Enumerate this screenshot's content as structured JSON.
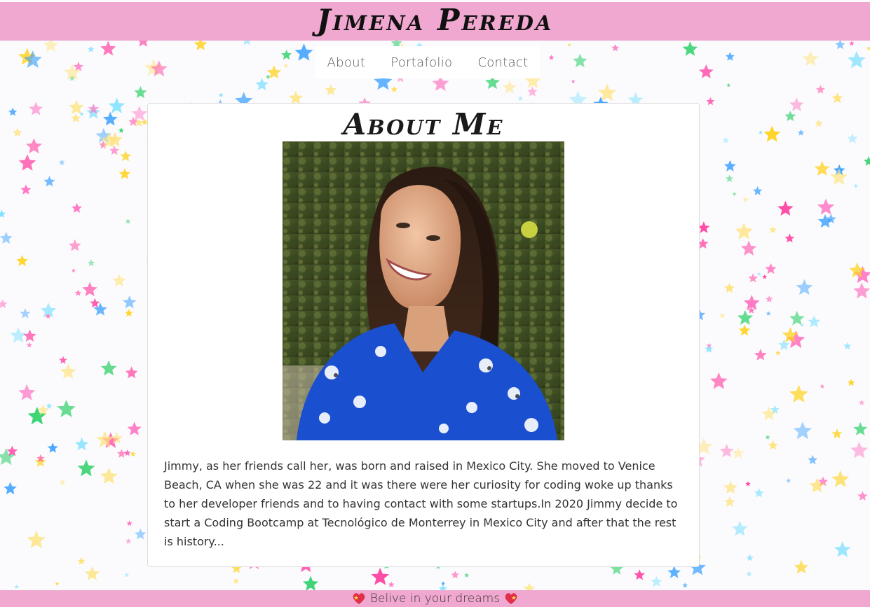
{
  "header": {
    "brand": "Jimena Pereda"
  },
  "nav": {
    "items": [
      {
        "label": "About"
      },
      {
        "label": "Portafolio"
      },
      {
        "label": "Contact"
      }
    ]
  },
  "about": {
    "title": "About Me",
    "photo_icon": "portrait-photo",
    "bio": "Jimmy, as her friends call her, was born and raised in Mexico City. She moved to Venice Beach, CA when she was 22 and it was there were her curiosity for  coding woke up thanks to her developer friends and to having contact with some startups.In 2020 Jimmy decide to start a Coding Bootcamp at Tecnológico de Monterrey in Mexico City and after that the rest is history..."
  },
  "footer": {
    "tagline": "Belive in your dreams",
    "icon": "sparkling-heart"
  },
  "colors": {
    "header_bg": "#f0a8d0",
    "footer_bg": "#f0a8d0",
    "card_bg": "#ffffff",
    "text": "#333333"
  }
}
